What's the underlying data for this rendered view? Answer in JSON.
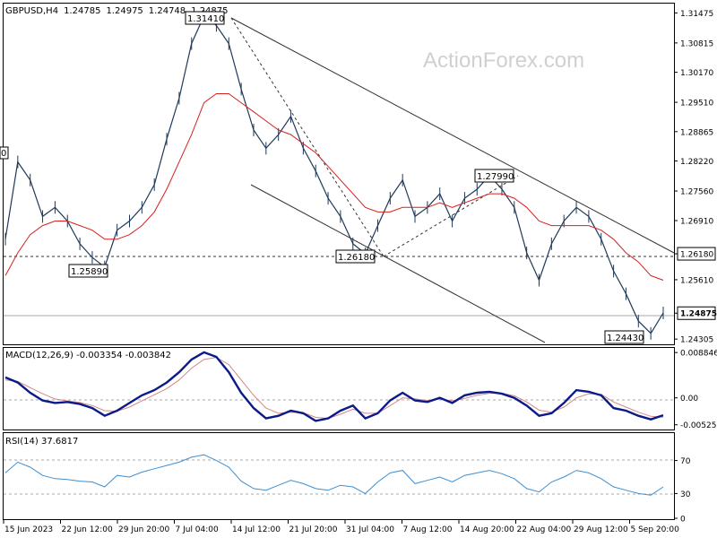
{
  "symbol": "GBPUSD,H4",
  "ohlc": [
    "1.24785",
    "1.24975",
    "1.24748",
    "1.24875"
  ],
  "watermark": "ActionForex.com",
  "colors": {
    "price": "#1f3a5a",
    "ma": "#d62020",
    "macd": "#0a1a8a",
    "signal": "#d08888",
    "rsi": "#3f8fd0",
    "grid": "#888888",
    "bg": "#ffffff"
  },
  "chart_data": [
    {
      "type": "line",
      "panel": "price",
      "title": "GBPUSD,H4 1.24785 1.24975 1.24748 1.24875",
      "ylim": [
        1.2419,
        1.3168
      ],
      "y_ticks": [
        "1.31475",
        "1.30815",
        "1.30170",
        "1.29510",
        "1.28865",
        "1.28220",
        "1.27560",
        "1.26910",
        "1.26180",
        "1.25610",
        "1.24875",
        "1.24305"
      ],
      "x_ticks": [
        "15 Jun 2023",
        "22 Jun 12:00",
        "29 Jun 20:00",
        "7 Jul 04:00",
        "14 Jul 12:00",
        "21 Jul 20:00",
        "31 Jul 04:00",
        "7 Aug 12:00",
        "14 Aug 20:00",
        "22 Aug 04:00",
        "29 Aug 12:00",
        "5 Sep 20:00"
      ],
      "series": [
        {
          "values": [
            1.265,
            1.282,
            1.278,
            1.27,
            1.272,
            1.269,
            1.264,
            1.261,
            1.2589,
            1.267,
            1.269,
            1.272,
            1.277,
            1.287,
            1.296,
            1.308,
            1.3141,
            1.312,
            1.308,
            1.298,
            1.289,
            1.285,
            1.288,
            1.292,
            1.285,
            1.28,
            1.274,
            1.27,
            1.264,
            1.2618,
            1.268,
            1.274,
            1.278,
            1.27,
            1.272,
            1.275,
            1.269,
            1.274,
            1.276,
            1.279,
            1.276,
            1.272,
            1.262,
            1.256,
            1.264,
            1.269,
            1.272,
            1.27,
            1.265,
            1.258,
            1.253,
            1.247,
            1.2443,
            1.2488
          ]
        },
        {
          "values": [
            1.257,
            1.262,
            1.266,
            1.268,
            1.269,
            1.269,
            1.268,
            1.267,
            1.265,
            1.265,
            1.266,
            1.268,
            1.271,
            1.276,
            1.282,
            1.288,
            1.295,
            1.297,
            1.297,
            1.295,
            1.293,
            1.291,
            1.289,
            1.288,
            1.286,
            1.284,
            1.281,
            1.278,
            1.275,
            1.272,
            1.271,
            1.271,
            1.272,
            1.272,
            1.272,
            1.273,
            1.272,
            1.273,
            1.274,
            1.275,
            1.275,
            1.274,
            1.272,
            1.269,
            1.268,
            1.268,
            1.268,
            1.268,
            1.267,
            1.265,
            1.262,
            1.26,
            1.257,
            1.256
          ]
        }
      ],
      "annotations": [
        "1.31410",
        "1.25890",
        "1.26180",
        "1.27990",
        "1.24430",
        "1.26180",
        "1.24875"
      ],
      "level_label": "0"
    },
    {
      "type": "line",
      "panel": "macd",
      "title": "MACD(12,26,9) -0.003354 -0.003842",
      "ylim": [
        -0.006,
        0.0094
      ],
      "y_ticks": [
        "0.008846",
        "0.00",
        "-0.005252"
      ],
      "series": [
        {
          "values": [
            0.004,
            0.003,
            0.001,
            -0.0005,
            -0.001,
            -0.0008,
            -0.0012,
            -0.002,
            -0.0035,
            -0.0025,
            -0.001,
            0.0005,
            0.0015,
            0.003,
            0.005,
            0.0075,
            0.0089,
            0.008,
            0.005,
            0.001,
            -0.002,
            -0.004,
            -0.0035,
            -0.0025,
            -0.003,
            -0.0045,
            -0.004,
            -0.0025,
            -0.0015,
            -0.004,
            -0.003,
            -0.0005,
            0.001,
            -0.0005,
            -0.0008,
            0.0,
            -0.001,
            0.0005,
            0.001,
            0.0012,
            0.0008,
            0.0,
            -0.0015,
            -0.0035,
            -0.003,
            -0.001,
            0.0015,
            0.0012,
            0.0005,
            -0.002,
            -0.0025,
            -0.0035,
            -0.0042,
            -0.0034
          ]
        },
        {
          "values": [
            0.0035,
            0.0032,
            0.002,
            0.0008,
            -0.0002,
            -0.0006,
            -0.0009,
            -0.0015,
            -0.0025,
            -0.0026,
            -0.0018,
            -0.0006,
            0.0006,
            0.0018,
            0.0035,
            0.0058,
            0.0075,
            0.0079,
            0.0065,
            0.0035,
            0.0005,
            -0.002,
            -0.003,
            -0.0028,
            -0.0029,
            -0.0038,
            -0.004,
            -0.0032,
            -0.0022,
            -0.003,
            -0.003,
            -0.0015,
            0.0,
            -0.0002,
            -0.0005,
            -0.0002,
            -0.0006,
            -0.0001,
            0.0005,
            0.0009,
            0.0009,
            0.0004,
            -0.0008,
            -0.0024,
            -0.0028,
            -0.0018,
            0.0,
            0.0008,
            0.0007,
            -0.0008,
            -0.0018,
            -0.0028,
            -0.0036,
            -0.0038
          ]
        }
      ]
    },
    {
      "type": "line",
      "panel": "rsi",
      "title": "RSI(14) 37.6817",
      "ylim": [
        0,
        100
      ],
      "y_ticks": [
        "70",
        "30",
        "0"
      ],
      "levels": [
        70,
        30
      ],
      "series": [
        {
          "values": [
            55,
            68,
            62,
            52,
            48,
            47,
            45,
            44,
            38,
            52,
            50,
            56,
            60,
            64,
            68,
            74,
            77,
            70,
            62,
            45,
            36,
            34,
            40,
            46,
            42,
            36,
            34,
            40,
            38,
            30,
            44,
            55,
            58,
            42,
            46,
            50,
            44,
            52,
            55,
            58,
            54,
            48,
            36,
            32,
            44,
            50,
            58,
            55,
            48,
            38,
            34,
            30,
            28,
            38
          ]
        }
      ]
    }
  ]
}
